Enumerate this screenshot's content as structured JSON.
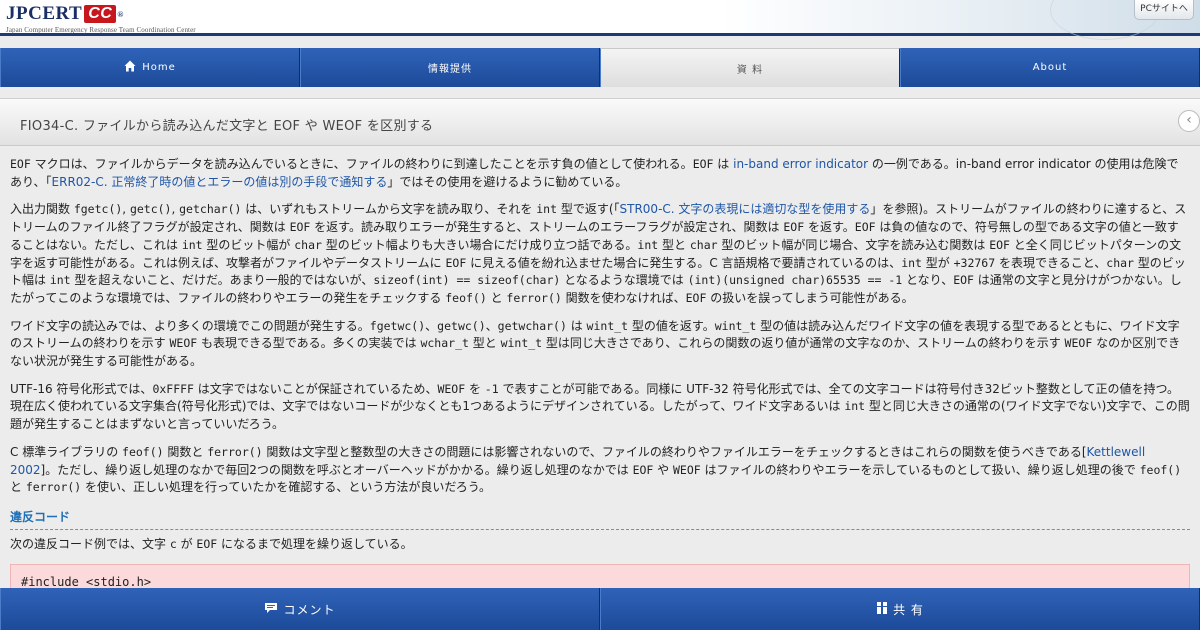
{
  "header": {
    "logo_text": "JPCERT",
    "logo_cc": "CC",
    "logo_reg": "®",
    "logo_subtitle": "Japan Computer Emergency Response Team Coordination Center",
    "pc_link": "PCサイトへ"
  },
  "nav": {
    "items": [
      {
        "label": "Home",
        "icon": "home-icon"
      },
      {
        "label": "情報提供"
      },
      {
        "label": "資 料",
        "active": true
      },
      {
        "label": "About"
      }
    ]
  },
  "title_bar": {
    "title": "FIO34-C. ファイルから読み込んだ文字と EOF や WEOF を区別する",
    "back_icon": "back-chevron-icon"
  },
  "content": {
    "p1": {
      "a": "EOF",
      "b": " マクロは、ファイルからデータを読み込んでいるときに、ファイルの終わりに到達したことを示す負の値として使われる。",
      "c": "EOF",
      "d": " は ",
      "link1": "in-band error indicator",
      "e": " の一例である。in-band error indicator の使用は危険であり、「",
      "link2": "ERR02-C. 正常終了時の値とエラーの値は別の手段で通知する",
      "f": "」ではその使用を避けるように勧めている。"
    },
    "p2": {
      "a": "入出力関数 ",
      "fn1": "fgetc()",
      "b": ", ",
      "fn2": "getc()",
      "c": ", ",
      "fn3": "getchar()",
      "d": " は、いずれもストリームから文字を読み取り、それを ",
      "t1": "int",
      "e": " 型で返す(「",
      "link": "STR00-C. 文字の表現には適切な型を使用する",
      "f": "」を参照)。ストリームがファイルの終わりに達すると、ストリームのファイル終了フラグが設定され、関数は ",
      "eof1": "EOF",
      "g": " を返す。読み取りエラーが発生すると、ストリームのエラーフラグが設定され、関数は ",
      "eof2": "EOF",
      "h": " を返す。",
      "eof3": "EOF",
      "i": " は負の値なので、符号無しの型である文字の値と一致することはない。ただし、これは ",
      "t2": "int",
      "j": " 型のビット幅が ",
      "t3": "char",
      "k": " 型のビット幅よりも大きい場合にだけ成り立つ話である。",
      "t4": "int",
      "l": " 型と ",
      "t5": "char",
      "m": " 型のビット幅が同じ場合、文字を読み込む関数は ",
      "eof4": "EOF",
      "n": " と全く同じビットパターンの文字を返す可能性がある。これは例えば、攻撃者がファイルやデータストリームに ",
      "eof5": "EOF",
      "o": " に見える値を紛れ込ませた場合に発生する。C 言語規格で要請されているのは、",
      "t6": "int",
      "p": " 型が ",
      "num1": "+32767",
      "q": " を表現できること、",
      "t7": "char",
      "r": " 型のビット幅は ",
      "t8": "int",
      "s": " 型を超えないこと、だけだ。あまり一般的ではないが、",
      "expr1": "sizeof(int) == sizeof(char)",
      "t": " となるような環境では ",
      "expr2": "(int)(unsigned char)65535 == -1",
      "u": " となり、",
      "eof6": "EOF",
      "v": " は通常の文字と見分けがつかない。したがってこのような環境では、ファイルの終わりやエラーの発生をチェックする ",
      "fn4": "feof()",
      "w": " と ",
      "fn5": "ferror()",
      "x": " 関数を使わなければ、",
      "eof7": "EOF",
      "y": " の扱いを誤ってしまう可能性がある。"
    },
    "p3": {
      "a": "ワイド文字の読込みでは、より多くの環境でこの問題が発生する。",
      "fn1": "fgetwc()",
      "b": "、",
      "fn2": "getwc()",
      "c": "、",
      "fn3": "getwchar()",
      "d": " は ",
      "t1": "wint_t",
      "e": " 型の値を返す。",
      "t2": "wint_t",
      "f": " 型の値は読み込んだワイド文字の値を表現する型であるとともに、ワイド文字のストリームの終わりを示す ",
      "w1": "WEOF",
      "g": " も表現できる型である。多くの実装では ",
      "t3": "wchar_t",
      "h": " 型と ",
      "t4": "wint_t",
      "i": " 型は同じ大きさであり、これらの関数の返り値が通常の文字なのか、ストリームの終わりを示す ",
      "w2": "WEOF",
      "j": " なのか区別できない状況が発生する可能性がある。"
    },
    "p4": {
      "a": "UTF-16 符号化形式では、",
      "v1": "0xFFFF",
      "b": " は文字ではないことが保証されているため、",
      "w1": "WEOF",
      "c": " を ",
      "v2": "-1",
      "d": " で表すことが可能である。同様に UTF-32 符号化形式では、全ての文字コードは符号付き32ビット整数として正の値を持つ。現在広く使われている文字集合(符号化形式)では、文字ではないコードが少なくとも1つあるようにデザインされている。したがって、ワイド文字あるいは ",
      "t1": "int",
      "e": " 型と同じ大きさの通常の(ワイド文字でない)文字で、この問題が発生することはまずないと言っていいだろう。"
    },
    "p5": {
      "a": "C 標準ライブラリの ",
      "fn1": "feof()",
      "b": " 関数と ",
      "fn2": "ferror()",
      "c": " 関数は文字型と整数型の大きさの問題には影響されないので、ファイルの終わりやファイルエラーをチェックするときはこれらの関数を使うべきである[",
      "link": "Kettlewell 2002",
      "d": "]。ただし、繰り返し処理のなかで毎回2つの関数を呼ぶとオーバーヘッドがかかる。繰り返し処理のなかでは ",
      "eof1": "EOF",
      "e": " や ",
      "w1": "WEOF",
      "f": " はファイルの終わりやエラーを示しているものとして扱い、繰り返し処理の後で ",
      "fn3": "feof()",
      "g": " と ",
      "fn4": "ferror()",
      "h": " を使い、正しい処理を行っていたかを確認する、という方法が良いだろう。"
    },
    "section_heading": "違反コード",
    "p6": {
      "a": "次の違反コード例では、文字 ",
      "c1": "c",
      "b": " が ",
      "eof1": "EOF",
      "c": " になるまで処理を繰り返している。"
    },
    "code_line": "#include <stdio.h>"
  },
  "bottom_bar": {
    "comment_label": "コメント",
    "share_label": "共 有"
  }
}
